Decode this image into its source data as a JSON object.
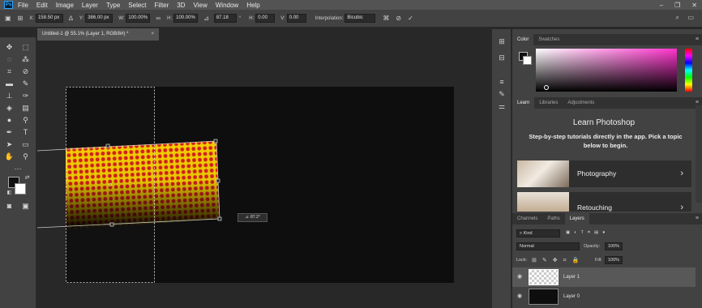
{
  "app": {
    "logo_text": "Ps",
    "menu": [
      "File",
      "Edit",
      "Image",
      "Layer",
      "Type",
      "Select",
      "Filter",
      "3D",
      "View",
      "Window",
      "Help"
    ],
    "window_controls": [
      "–",
      "❐",
      "✕"
    ]
  },
  "options_bar": {
    "x_label": "X:",
    "x_value": "158.50 px",
    "y_label": "Y:",
    "y_value": "386.00 px",
    "w_label": "W:",
    "w_value": "100.00%",
    "h_label": "H:",
    "h_value": "100.00%",
    "angle_value": "87.18",
    "angle_unit": "°",
    "hskew_label": "H:",
    "hskew_value": "0.00",
    "vskew_label": "V:",
    "vskew_value": "0.00",
    "interp_label": "Interpolation:",
    "interp_value": "Bicubic"
  },
  "document": {
    "tab_title": "Untitled-1 @ 55.1% (Layer 1, RGB/8#) *",
    "tab_close": "×",
    "transform_readout": "⊿: 87.2°"
  },
  "panels": {
    "color_tabs": [
      "Color",
      "Swatches"
    ],
    "learn_tabs": [
      "Learn",
      "Libraries",
      "Adjustments"
    ],
    "learn_title": "Learn Photoshop",
    "learn_desc": "Step-by-step tutorials directly in the app. Pick a topic below to begin.",
    "learn_cards": [
      {
        "label": "Photography"
      },
      {
        "label": "Retouching"
      }
    ],
    "layers_tabs": [
      "Channels",
      "Paths",
      "Layers"
    ],
    "kind_label": "Kind",
    "blend_mode": "Normal",
    "opacity_label": "Opacity:",
    "opacity_value": "100%",
    "lock_label": "Lock:",
    "fill_label": "Fill:",
    "fill_value": "100%",
    "layers": [
      {
        "name": "Layer 1"
      },
      {
        "name": "Layer 0"
      }
    ]
  },
  "colors": {
    "foreground": "#111111",
    "background": "#ffffff",
    "picker_hue": "#ff33cc"
  }
}
